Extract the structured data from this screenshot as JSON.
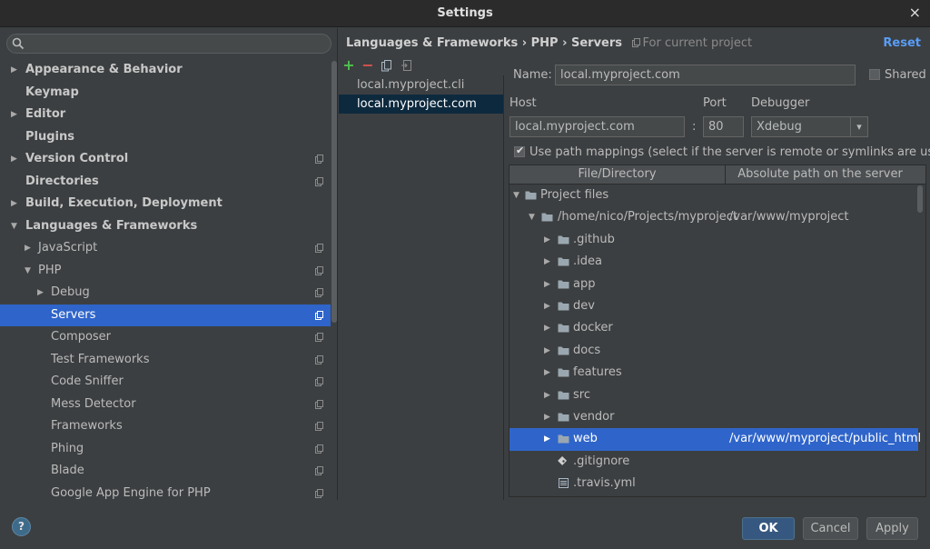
{
  "window": {
    "title": "Settings",
    "close_icon": "×"
  },
  "search": {
    "placeholder": "",
    "icon": "search-icon"
  },
  "sidebar": {
    "items": [
      {
        "label": "Appearance & Behavior",
        "arrow": "▶",
        "bold": true
      },
      {
        "label": "Keymap",
        "arrow": "",
        "bold": true
      },
      {
        "label": "Editor",
        "arrow": "▶",
        "bold": true
      },
      {
        "label": "Plugins",
        "arrow": "",
        "bold": true
      },
      {
        "label": "Version Control",
        "arrow": "▶",
        "bold": true,
        "project_icon": true
      },
      {
        "label": "Directories",
        "arrow": "",
        "bold": true,
        "project_icon": true
      },
      {
        "label": "Build, Execution, Deployment",
        "arrow": "▶",
        "bold": true
      },
      {
        "label": "Languages & Frameworks",
        "arrow": "▼",
        "bold": true
      },
      {
        "label": "JavaScript",
        "arrow": "▶",
        "indent": 1,
        "project_icon": true
      },
      {
        "label": "PHP",
        "arrow": "▼",
        "indent": 1,
        "project_icon": true
      },
      {
        "label": "Debug",
        "arrow": "▶",
        "indent": 2,
        "project_icon": true
      },
      {
        "label": "Servers",
        "arrow": "",
        "indent": 2,
        "project_icon": true,
        "selected": true
      },
      {
        "label": "Composer",
        "arrow": "",
        "indent": 2,
        "project_icon": true
      },
      {
        "label": "Test Frameworks",
        "arrow": "",
        "indent": 2,
        "project_icon": true
      },
      {
        "label": "Code Sniffer",
        "arrow": "",
        "indent": 2,
        "project_icon": true
      },
      {
        "label": "Mess Detector",
        "arrow": "",
        "indent": 2,
        "project_icon": true
      },
      {
        "label": "Frameworks",
        "arrow": "",
        "indent": 2,
        "project_icon": true
      },
      {
        "label": "Phing",
        "arrow": "",
        "indent": 2,
        "project_icon": true
      },
      {
        "label": "Blade",
        "arrow": "",
        "indent": 2,
        "project_icon": true
      },
      {
        "label": "Google App Engine for PHP",
        "arrow": "",
        "indent": 2,
        "project_icon": true
      }
    ]
  },
  "breadcrumb": {
    "path": "Languages & Frameworks › PHP › Servers",
    "hint": "For current project",
    "reset_label": "Reset"
  },
  "server_toolbar": {
    "add": "+",
    "remove": "−"
  },
  "servers": [
    {
      "label": "local.myproject.cli",
      "selected": false
    },
    {
      "label": "local.myproject.com",
      "selected": true
    }
  ],
  "form": {
    "name_label": "Name:",
    "name_value": "local.myproject.com",
    "shared_label": "Shared",
    "shared_checked": false,
    "host_label": "Host",
    "host_value": "local.myproject.com",
    "colon": ":",
    "port_label": "Port",
    "port_value": "80",
    "debugger_label": "Debugger",
    "debugger_value": "Xdebug",
    "debugger_arrow": "▾",
    "path_mappings_label": "Use path mappings (select if the server is remote or symlinks are used)",
    "path_mappings_checked": true
  },
  "mapping": {
    "col_file": "File/Directory",
    "col_server": "Absolute path on the server",
    "rows": [
      {
        "name": "Project files",
        "remote": "",
        "arrow": "▼",
        "indent": 0,
        "icon": "folder-icon"
      },
      {
        "name": "/home/nico/Projects/myproject",
        "remote": "/var/www/myproject",
        "arrow": "▼",
        "indent": 1,
        "icon": "folder-icon"
      },
      {
        "name": ".github",
        "remote": "",
        "arrow": "▶",
        "indent": 2,
        "icon": "folder-icon"
      },
      {
        "name": ".idea",
        "remote": "",
        "arrow": "▶",
        "indent": 2,
        "icon": "folder-icon"
      },
      {
        "name": "app",
        "remote": "",
        "arrow": "▶",
        "indent": 2,
        "icon": "folder-icon"
      },
      {
        "name": "dev",
        "remote": "",
        "arrow": "▶",
        "indent": 2,
        "icon": "folder-icon"
      },
      {
        "name": "docker",
        "remote": "",
        "arrow": "▶",
        "indent": 2,
        "icon": "folder-icon"
      },
      {
        "name": "docs",
        "remote": "",
        "arrow": "▶",
        "indent": 2,
        "icon": "folder-icon"
      },
      {
        "name": "features",
        "remote": "",
        "arrow": "▶",
        "indent": 2,
        "icon": "folder-icon"
      },
      {
        "name": "src",
        "remote": "",
        "arrow": "▶",
        "indent": 2,
        "icon": "folder-icon"
      },
      {
        "name": "vendor",
        "remote": "",
        "arrow": "▶",
        "indent": 2,
        "icon": "folder-icon"
      },
      {
        "name": "web",
        "remote": "/var/www/myproject/public_html",
        "arrow": "▶",
        "indent": 2,
        "icon": "folder-icon",
        "selected": true
      },
      {
        "name": ".gitignore",
        "remote": "",
        "arrow": "",
        "indent": 2,
        "icon": "git-file-icon"
      },
      {
        "name": ".travis.yml",
        "remote": "",
        "arrow": "",
        "indent": 2,
        "icon": "yaml-file-icon"
      }
    ]
  },
  "footer": {
    "help": "?",
    "ok": "OK",
    "cancel": "Cancel",
    "apply": "Apply"
  },
  "colors": {
    "accent": "#2f65ca",
    "link": "#589df6",
    "background": "#3c3f41"
  }
}
